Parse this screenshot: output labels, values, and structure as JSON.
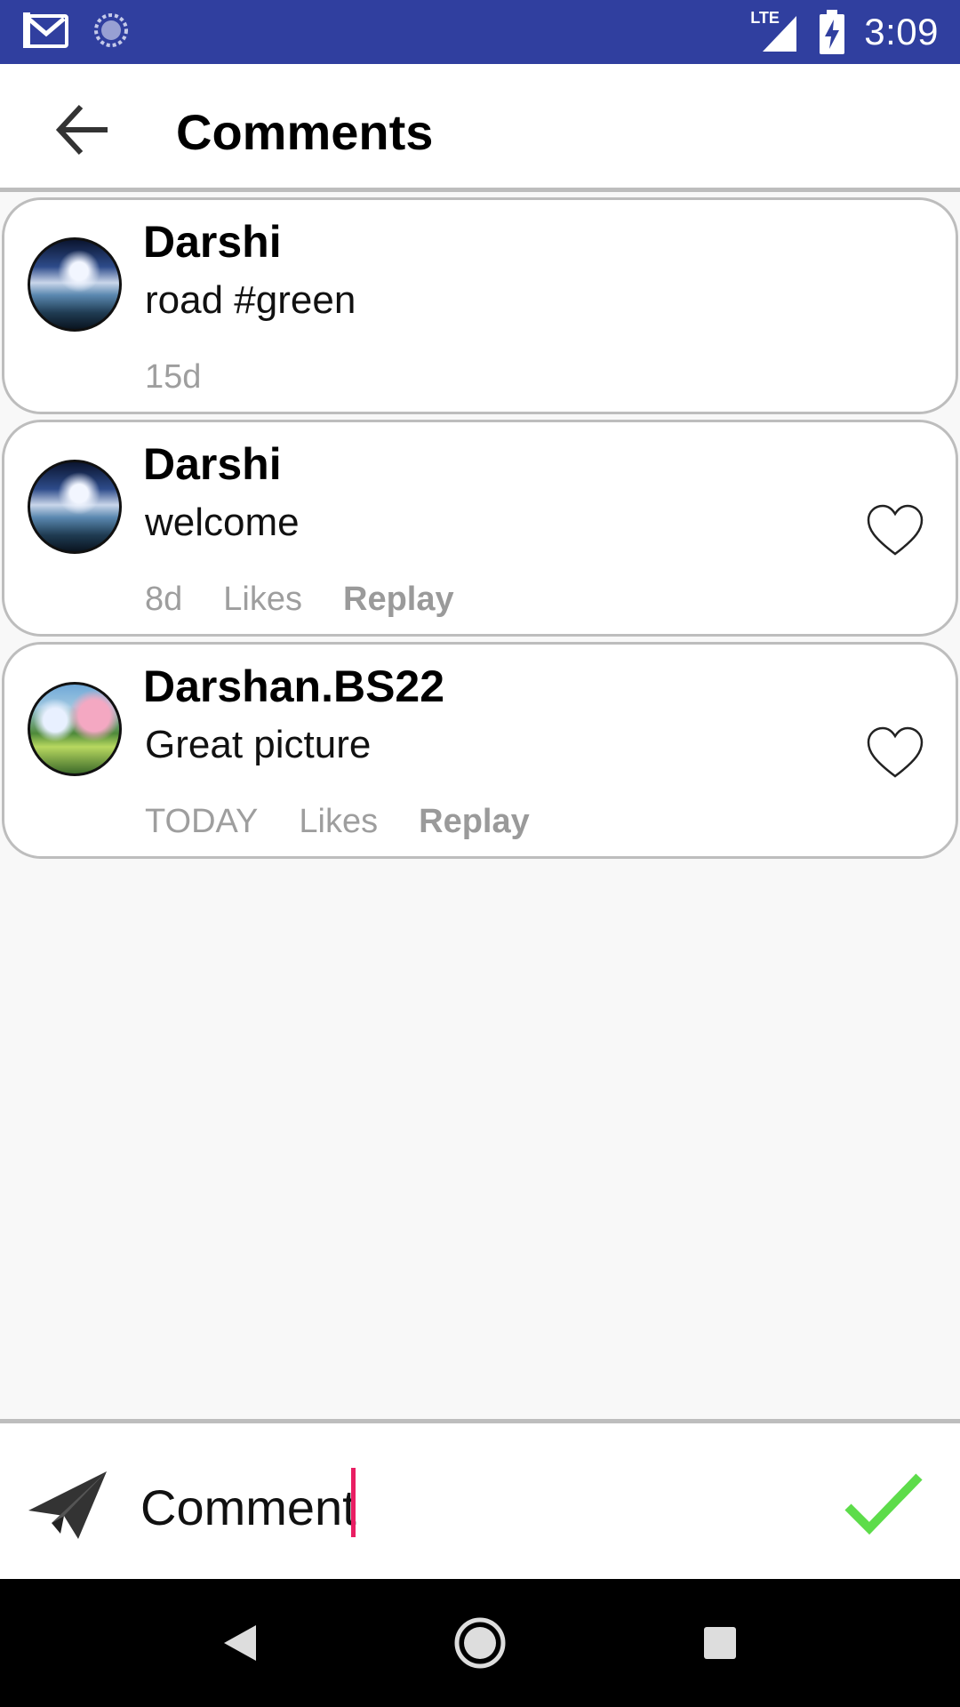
{
  "status_bar": {
    "left_icons": [
      "gmail-icon",
      "sync-icon"
    ],
    "network": "LTE",
    "right_icons": [
      "lte-signal-icon",
      "battery-charging-icon"
    ],
    "time": "3:09",
    "background": "#303f9f"
  },
  "app_bar": {
    "title": "Comments",
    "back_icon": "arrow-left-icon"
  },
  "comments": [
    {
      "author": "Darshi",
      "text": "road #green",
      "time": "15d",
      "likes_label": "",
      "reply_label": "",
      "has_like_button": false
    },
    {
      "author": "Darshi",
      "text": "welcome",
      "time": "8d",
      "likes_label": "Likes",
      "reply_label": "Replay",
      "has_like_button": true
    },
    {
      "author": "Darshan.BS22",
      "text": "Great picture",
      "time": "TODAY",
      "likes_label": "Likes",
      "reply_label": "Replay",
      "has_like_button": true
    }
  ],
  "composer": {
    "value": "Comment",
    "send_icon": "paper-plane-icon",
    "submit_icon": "check-icon",
    "submit_color": "#5ddc4a",
    "caret_color": "#e91e63"
  },
  "nav_bar": {
    "buttons": [
      "back-triangle-icon",
      "home-circle-icon",
      "recents-square-icon"
    ]
  }
}
